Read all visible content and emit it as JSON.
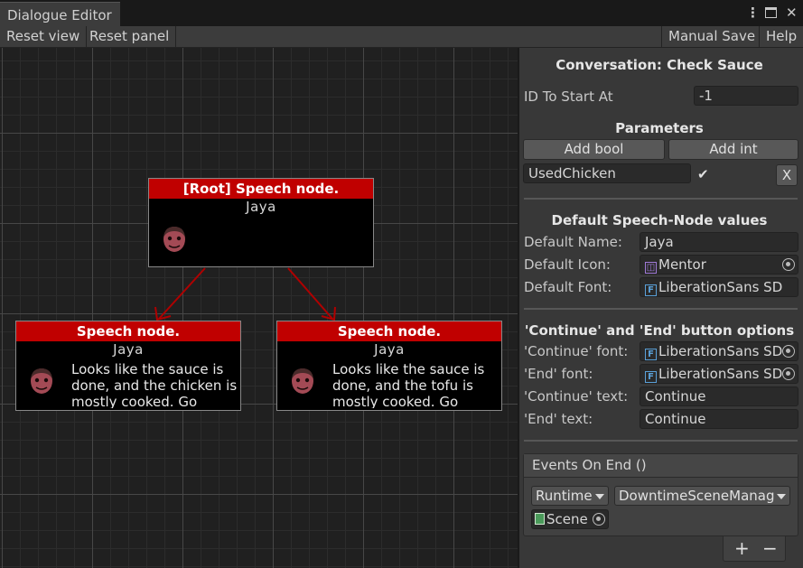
{
  "window": {
    "tab_title": "Dialogue Editor",
    "menu_glyph": "⋮",
    "maximize_glyph": "□",
    "close_glyph": "✕"
  },
  "toolbar": {
    "reset_view": "Reset view",
    "reset_panel": "Reset panel",
    "manual_save": "Manual Save",
    "help": "Help"
  },
  "graph": {
    "nodes": [
      {
        "header": "[Root] Speech node.",
        "speaker": "Jaya",
        "text": ""
      },
      {
        "header": "Speech node.",
        "speaker": "Jaya",
        "text": "Looks like the sauce is done, and the chicken is mostly cooked. Go"
      },
      {
        "header": "Speech node.",
        "speaker": "Jaya",
        "text": "Looks like the sauce is done, and the tofu is mostly cooked. Go"
      }
    ],
    "colors": {
      "node_header": "#c00000",
      "edge": "#b00000",
      "node_body": "#000000"
    }
  },
  "inspector": {
    "conversation_title": "Conversation: Check Sauce",
    "id_start_label": "ID To Start At",
    "id_start_value": "-1",
    "parameters_title": "Parameters",
    "add_bool": "Add bool",
    "add_int": "Add int",
    "param_name": "UsedChicken",
    "param_checked": "✔",
    "param_remove": "X",
    "defaults_title": "Default Speech-Node values",
    "default_name_label": "Default Name:",
    "default_name_value": "Jaya",
    "default_icon_label": "Default Icon:",
    "default_icon_value": "Mentor",
    "default_font_label": "Default Font:",
    "default_font_value": "LiberationSans SD",
    "buttons_title": "'Continue' and 'End' button options",
    "continue_font_label": "'Continue' font:",
    "continue_font_value": "LiberationSans SD",
    "end_font_label": "'End' font:",
    "end_font_value": "LiberationSans SD",
    "continue_text_label": "'Continue' text:",
    "continue_text_value": "Continue",
    "end_text_label": "'End' text:",
    "end_text_value": "Continue",
    "events_title": "Events On End ()",
    "runtime_option": "Runtime",
    "target_option": "DowntimeSceneManag",
    "object_value": "Scene",
    "add_glyph": "+",
    "remove_glyph": "−"
  }
}
